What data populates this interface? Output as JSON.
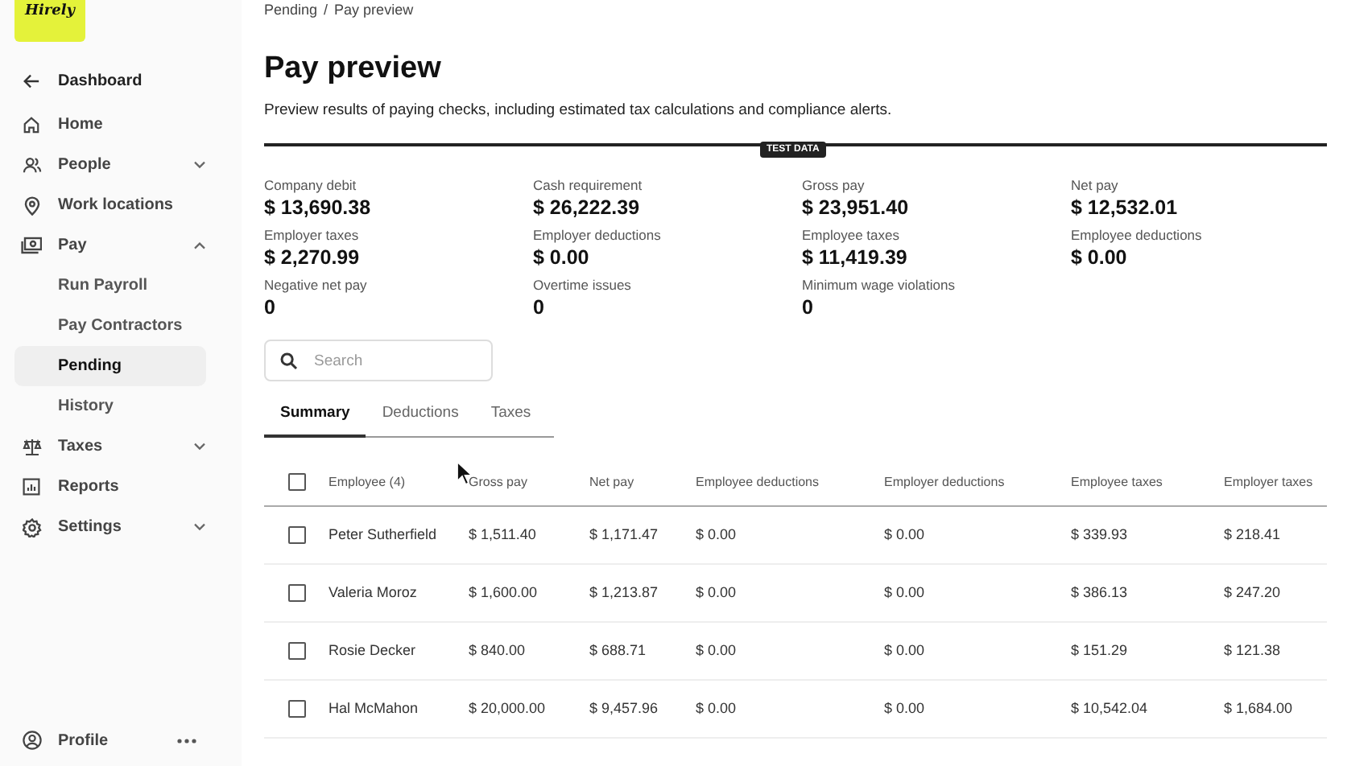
{
  "logo": "Hirely",
  "nav": [
    {
      "label": "Dashboard"
    },
    {
      "label": "Home"
    },
    {
      "label": "People",
      "expanded": false
    },
    {
      "label": "Work locations"
    },
    {
      "label": "Pay",
      "expanded": true,
      "children": [
        {
          "label": "Run Payroll",
          "selected": false
        },
        {
          "label": "Pay Contractors",
          "selected": false
        },
        {
          "label": "Pending",
          "selected": true
        },
        {
          "label": "History",
          "selected": false
        }
      ]
    },
    {
      "label": "Taxes",
      "expanded": false
    },
    {
      "label": "Reports"
    },
    {
      "label": "Settings",
      "expanded": false
    }
  ],
  "profile": {
    "label": "Profile"
  },
  "breadcrumb": {
    "items": [
      "Pending",
      "Pay preview"
    ],
    "separator": "/"
  },
  "title": "Pay preview",
  "description": "Preview results of paying checks, including estimated tax calculations and compliance alerts.",
  "badge": "TEST DATA",
  "stats": [
    {
      "label": "Company debit",
      "value": "$ 13,690.38"
    },
    {
      "label": "Cash requirement",
      "value": "$ 26,222.39"
    },
    {
      "label": "Gross pay",
      "value": "$ 23,951.40"
    },
    {
      "label": "Net pay",
      "value": "$ 12,532.01"
    },
    {
      "label": "Employer taxes",
      "value": "$ 2,270.99"
    },
    {
      "label": "Employer deductions",
      "value": "$ 0.00"
    },
    {
      "label": "Employee taxes",
      "value": "$ 11,419.39"
    },
    {
      "label": "Employee deductions",
      "value": "$ 0.00"
    },
    {
      "label": "Negative net pay",
      "value": "0"
    },
    {
      "label": "Overtime issues",
      "value": "0"
    },
    {
      "label": "Minimum wage violations",
      "value": "0"
    }
  ],
  "search": {
    "placeholder": "Search"
  },
  "tabs": [
    {
      "label": "Summary",
      "selected": true
    },
    {
      "label": "Deductions",
      "selected": false
    },
    {
      "label": "Taxes",
      "selected": false
    }
  ],
  "table": {
    "header_checked": false,
    "columns": [
      "Employee (4)",
      "Gross pay",
      "Net pay",
      "Employee deductions",
      "Employer deductions",
      "Employee taxes",
      "Employer taxes"
    ],
    "rows": [
      {
        "checked": false,
        "cells": [
          "Peter Sutherfield",
          "$ 1,511.40",
          "$ 1,171.47",
          "$ 0.00",
          "$ 0.00",
          "$ 339.93",
          "$ 218.41"
        ]
      },
      {
        "checked": false,
        "cells": [
          "Valeria Moroz",
          "$ 1,600.00",
          "$ 1,213.87",
          "$ 0.00",
          "$ 0.00",
          "$ 386.13",
          "$ 247.20"
        ]
      },
      {
        "checked": false,
        "cells": [
          "Rosie Decker",
          "$ 840.00",
          "$ 688.71",
          "$ 0.00",
          "$ 0.00",
          "$ 151.29",
          "$ 121.38"
        ]
      },
      {
        "checked": false,
        "cells": [
          "Hal McMahon",
          "$ 20,000.00",
          "$ 9,457.96",
          "$ 0.00",
          "$ 0.00",
          "$ 10,542.04",
          "$ 1,684.00"
        ]
      }
    ]
  }
}
